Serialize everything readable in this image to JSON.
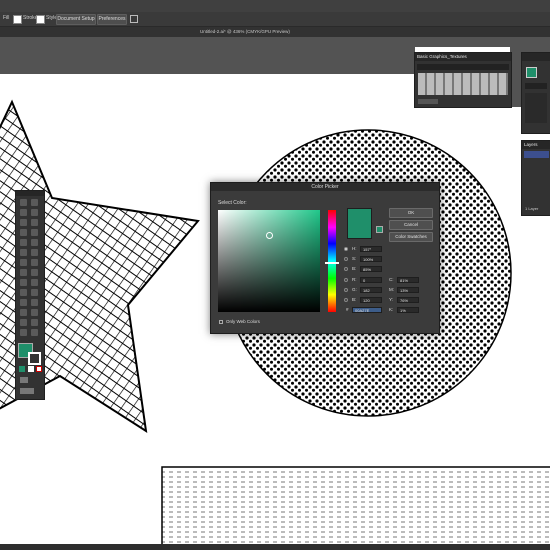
{
  "app_bar": {
    "items": [
      {
        "label": "Fill"
      },
      {
        "label": "Stroke"
      },
      {
        "label": "Style"
      },
      {
        "label": "Document Setup"
      },
      {
        "label": "Preferences"
      }
    ]
  },
  "document": {
    "tab_title": "Untitled-2.ai* @ 436% (CMYK/GPU Preview)"
  },
  "graphics_panel": {
    "title": "Basic Graphics_Textures"
  },
  "layers_panel": {
    "title": "Layers",
    "footer": "1 Layer"
  },
  "color_picker": {
    "title": "Color Picker",
    "select_color_label": "Select Color:",
    "ok_label": "OK",
    "cancel_label": "Cancel",
    "swatches_label": "Color Swatches",
    "only_web_colors_label": "Only Web Colors",
    "selected_color": "#1f8f6a",
    "fields": {
      "H": {
        "label": "H:",
        "value": "157°"
      },
      "S": {
        "label": "S:",
        "value": "100%"
      },
      "B": {
        "label": "B:",
        "value": "85%"
      },
      "R": {
        "label": "R:",
        "value": "0"
      },
      "G": {
        "label": "G:",
        "value": "182"
      },
      "Bl": {
        "label": "B:",
        "value": "120"
      },
      "C": {
        "label": "C:",
        "value": "81%"
      },
      "M": {
        "label": "M:",
        "value": "13%"
      },
      "Y": {
        "label": "Y:",
        "value": "76%"
      },
      "K": {
        "label": "K:",
        "value": "1%"
      },
      "hex": {
        "label": "#",
        "value": "00A27E"
      }
    }
  },
  "toolbar": {
    "fill_color": "#1f8f6a"
  }
}
